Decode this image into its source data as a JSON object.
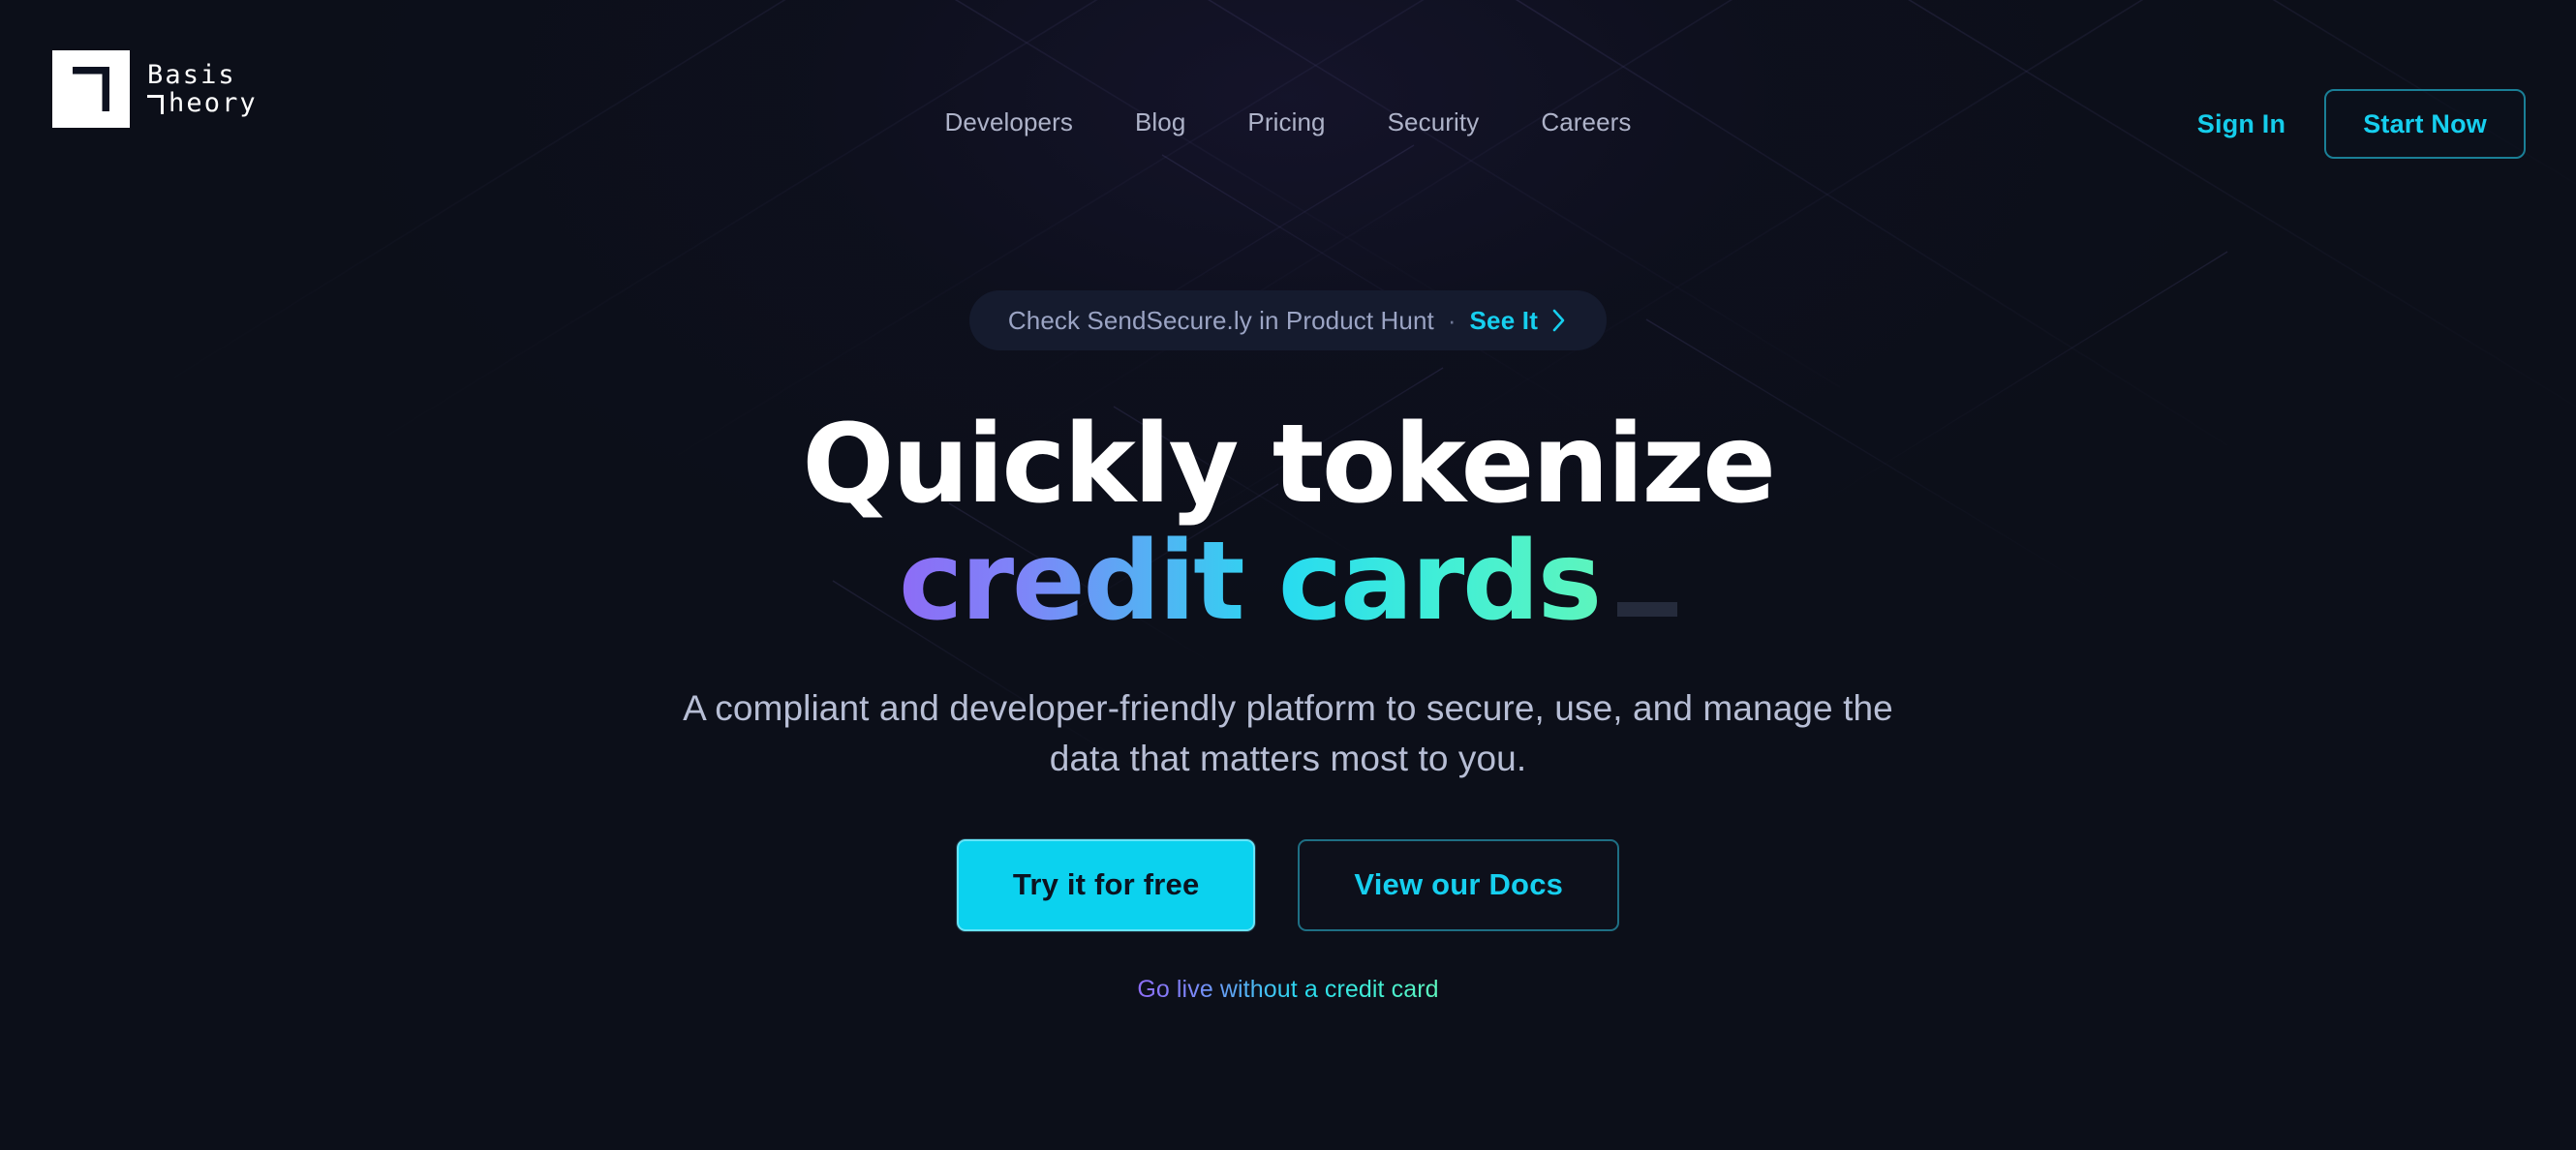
{
  "brand": {
    "line1": "Basis",
    "line2": "heory",
    "mark_icon": "basis-theory-logo-icon",
    "full_name": "Basis Theory"
  },
  "nav": {
    "items": [
      {
        "label": "Developers"
      },
      {
        "label": "Blog"
      },
      {
        "label": "Pricing"
      },
      {
        "label": "Security"
      },
      {
        "label": "Careers"
      }
    ]
  },
  "header_actions": {
    "sign_in_label": "Sign In",
    "start_now_label": "Start Now"
  },
  "announcement": {
    "text": "Check SendSecure.ly in Product Hunt",
    "separator": "·",
    "cta_label": "See It",
    "chevron_icon": "chevron-right-icon"
  },
  "hero": {
    "title_line1": "Quickly tokenize",
    "title_line2": "credit cards",
    "subtitle": "A compliant and developer-friendly platform to secure, use, and manage the data that matters most to you.",
    "primary_cta": "Try it for free",
    "secondary_cta": "View our Docs",
    "note": "Go live without a credit card"
  },
  "colors": {
    "background": "#0c0f19",
    "accent_cyan": "#16cfef",
    "primary_button": "#0bd2ef",
    "pill_background": "#151b2e",
    "nav_text": "#aeb3c9",
    "subtitle_text": "#b7bed5",
    "gradient_start": "#8d6cf6",
    "gradient_mid": "#28dbf0",
    "gradient_end": "#5df5bd",
    "caret": "#252b3c"
  }
}
